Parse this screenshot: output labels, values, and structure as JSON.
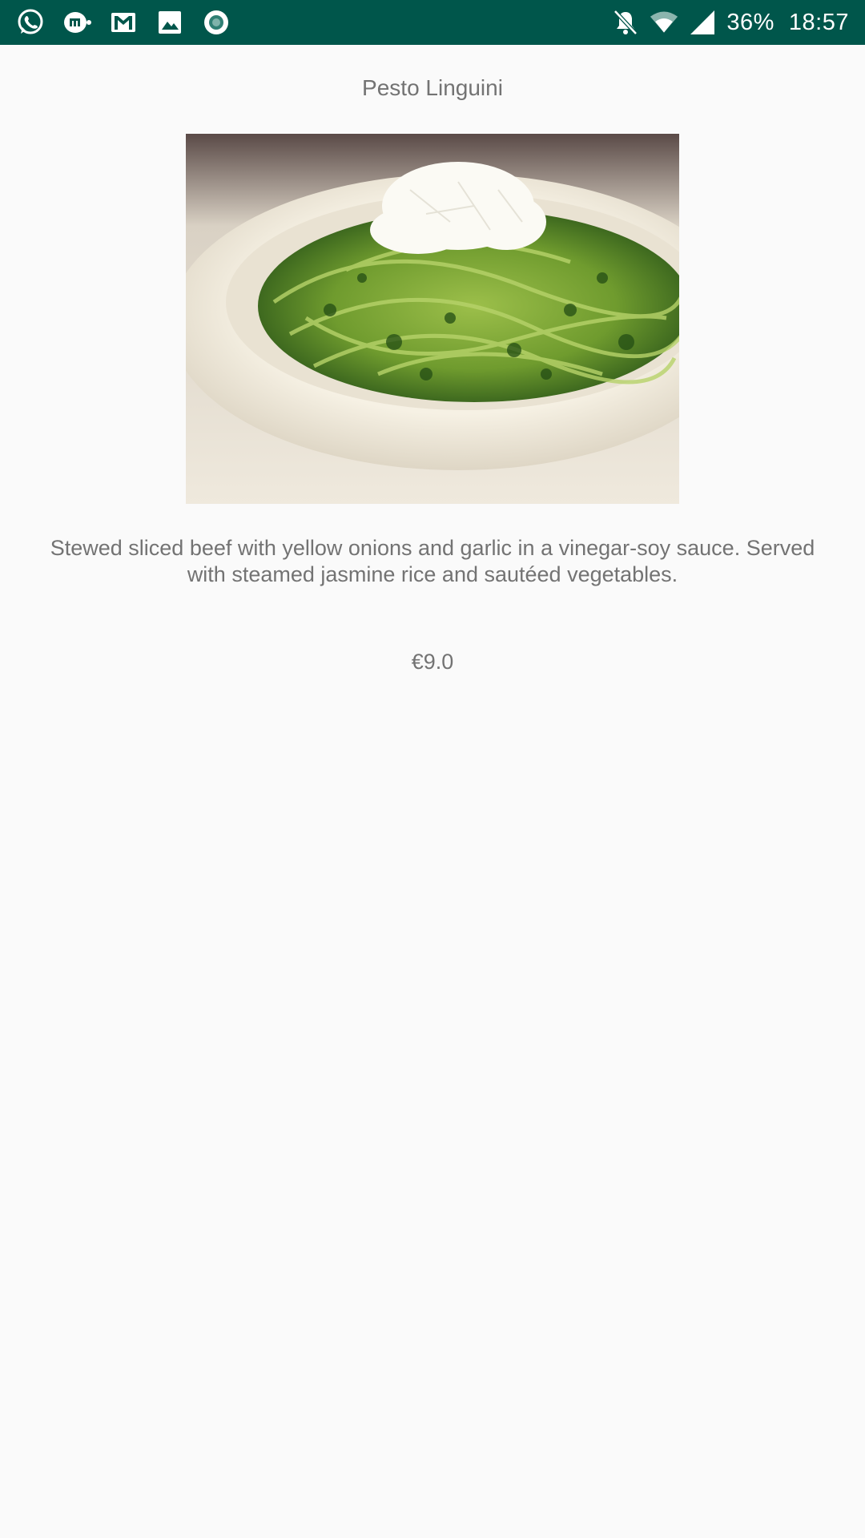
{
  "status_bar": {
    "background": "#00564b",
    "left_icons": [
      "whatsapp-icon",
      "messenger-app-icon",
      "gmail-icon",
      "gallery-icon",
      "record-icon"
    ],
    "right_icons": [
      "notifications-off-icon",
      "wifi-icon",
      "cell-signal-icon"
    ],
    "battery": "36%",
    "time": "18:57"
  },
  "dish": {
    "title": "Pesto Linguini",
    "image_icon": "pesto-linguini-photo",
    "description": "Stewed sliced beef with yellow onions and garlic in a vinegar-soy sauce. Served with steamed jasmine rice and sautéed vegetables.",
    "price": "€9.0"
  },
  "colors": {
    "page_background": "#fafafa",
    "text": "#737373"
  }
}
